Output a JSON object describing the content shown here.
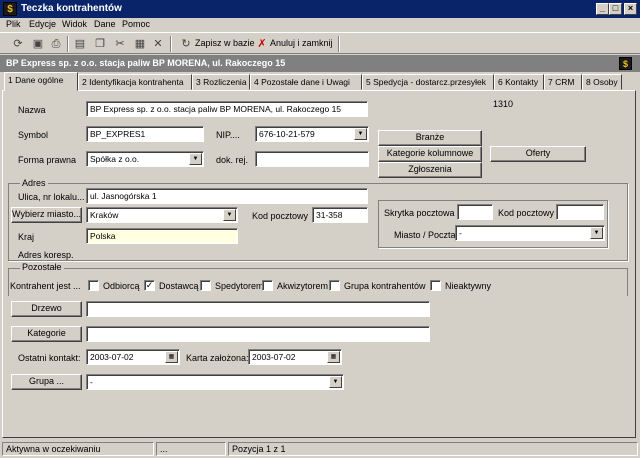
{
  "window": {
    "title": "Teczka kontrahentów"
  },
  "menu": [
    "Plik",
    "Edycje",
    "Widok",
    "Dane",
    "Pomoc"
  ],
  "toolbar": {
    "save_label": "Zapisz w bazie",
    "cancel_label": "Anuluj i zamknij"
  },
  "record": {
    "title": "BP Express sp. z o.o. stacja paliw BP MORENA, ul. Rakoczego 15"
  },
  "tabs": [
    {
      "label": "1 Dane ogólne"
    },
    {
      "label": "2 Identyfikacja kontrahenta"
    },
    {
      "label": "3 Rozliczenia"
    },
    {
      "label": "4 Pozostałe dane i Uwagi"
    },
    {
      "label": "5 Spedycja - dostarcz.przesyłek"
    },
    {
      "label": "6 Kontakty"
    },
    {
      "label": "7 CRM"
    },
    {
      "label": "8 Osoby"
    }
  ],
  "form": {
    "id_number": "1310",
    "name_label": "Nazwa",
    "name_value": "BP Express sp. z o.o. stacja paliw BP MORENA, ul. Rakoczego 15",
    "symbol_label": "Symbol",
    "symbol_value": "BP_EXPRES1",
    "nip_label": "NIP....",
    "nip_value": "676-10-21-579",
    "legal_form_label": "Forma prawna",
    "legal_form_value": "Spółka z o.o.",
    "doc_label": "dok. rej.",
    "doc_value": "",
    "branze_button": "Branże",
    "categories_button": "Kategorie kolumnowe",
    "reports_button": "Zgłoszenia",
    "offers_button": "Oferty",
    "address_group": "Adres",
    "street_label": "Ulica, nr lokalu...",
    "street_value": "ul. Jasnogórska 1",
    "city_button": "Wybierz miasto...",
    "city_value": "Kraków",
    "postal_label": "Kod pocztowy",
    "postal_value": "31-358",
    "country_label": "Kraj",
    "country_value": "Polska",
    "corr_address_label": "Adres koresp.",
    "pobox_label": "Skrytka pocztowa",
    "pobox_value": "",
    "pobox_postal_label": "Kod pocztowy",
    "pobox_postal_value": "",
    "city_post_label": "Miasto / Poczta",
    "city_post_value": "-",
    "other_group": "Pozostałe",
    "contractor_is_label": "Kontrahent jest ...",
    "checks": [
      {
        "label": "Odbiorcą",
        "checked": false
      },
      {
        "label": "Dostawcą",
        "checked": true
      },
      {
        "label": "Spedytorem",
        "checked": false
      },
      {
        "label": "Akwizytorem",
        "checked": false
      },
      {
        "label": "Grupa kontrahentów",
        "checked": false
      },
      {
        "label": "Nieaktywny",
        "checked": false
      }
    ],
    "check_mark": "✓",
    "tree_button": "Drzewo",
    "tree_value": "",
    "category_button": "Kategorie",
    "category_value": "",
    "last_contact_label": "Ostatni kontakt:",
    "last_contact_value": "2003-07-02",
    "card_created_label": "Karta założona:",
    "card_created_value": "2003-07-02",
    "group_button": "Grupa ...",
    "group_value": "-"
  },
  "status": {
    "state": "Aktywna w oczekiwaniu",
    "extra": "...",
    "position": "Pozycja 1 z 1"
  }
}
